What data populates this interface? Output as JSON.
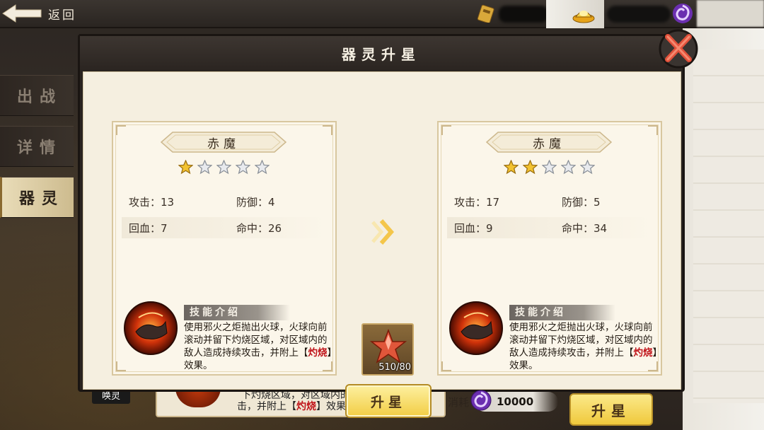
{
  "topbar": {
    "back_label": "返回"
  },
  "side_tabs": [
    {
      "label": "出战",
      "active": false
    },
    {
      "label": "详情",
      "active": false
    },
    {
      "label": "器灵",
      "active": true
    }
  ],
  "modal": {
    "title": "器灵升星",
    "left_card": {
      "name": "赤魔",
      "stars_filled": 1,
      "stars_total": 5,
      "stats": {
        "attack": "攻击：13",
        "defense": "防御：4",
        "heal": "回血：7",
        "hit": "命中：26"
      },
      "skill_title": "技能介绍",
      "skill_desc_pre": "使用邪火之炬抛出火球，火球向前滚动并留下灼烧区域，对区域内的敌人造成持续攻击，并附上【",
      "skill_keyword": "灼烧",
      "skill_desc_post": "】效果。"
    },
    "right_card": {
      "name": "赤魔",
      "stars_filled": 2,
      "stars_total": 5,
      "stats": {
        "attack": "攻击：17",
        "defense": "防御：5",
        "heal": "回血：9",
        "hit": "命中：34"
      },
      "skill_title": "技能介绍",
      "skill_desc_pre": "使用邪火之炬抛出火球，火球向前滚动并留下灼烧区域，对区域内的敌人造成持续攻击，并附上【",
      "skill_keyword": "灼烧",
      "skill_desc_post": "】效果。"
    },
    "material_count": "510/80",
    "upgrade_label": "升星",
    "cost_label": "消耗",
    "cost_value": "10000"
  },
  "background": {
    "huanling_label": "唤灵",
    "skill_text_line1": "下灼烧区域，对区域内的敌人造成持续攻",
    "skill_text_pre": "击，并附上【",
    "skill_keyword": "灼烧",
    "skill_text_post": "】效果。",
    "upgrade_label": "升星"
  },
  "colors": {
    "accent_gold": "#f2cd44",
    "keyword_red": "#c0141a",
    "panel_cream": "#f5efe0"
  }
}
